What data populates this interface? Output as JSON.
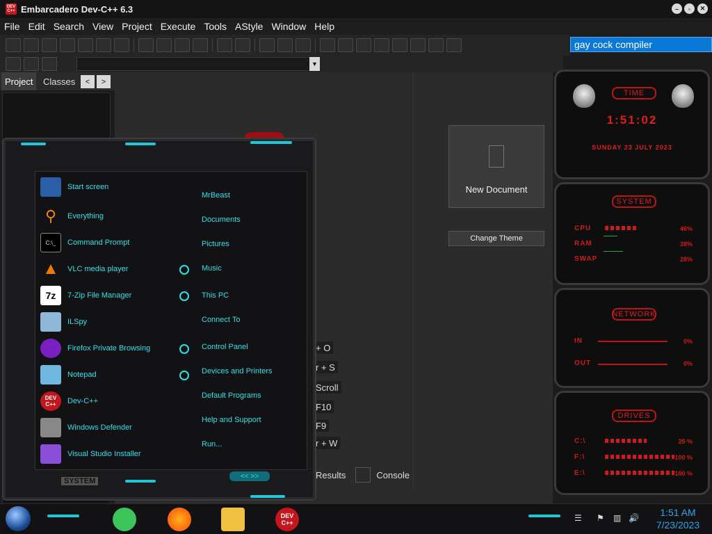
{
  "window": {
    "title": "Embarcadero Dev-C++ 6.3",
    "app_icon_text": "DEV C++"
  },
  "menu": [
    "File",
    "Edit",
    "Search",
    "View",
    "Project",
    "Execute",
    "Tools",
    "AStyle",
    "Window",
    "Help"
  ],
  "search": {
    "value": "gay cock compiler"
  },
  "left_panel": {
    "tab_project": "Project",
    "tab_classes": "Classes",
    "prev": "<",
    "next": ">"
  },
  "editor": {
    "new_document": "New Document",
    "change_theme": "Change Theme",
    "shortcuts": [
      "+ O",
      "r + S",
      "Scroll",
      "F10",
      "F9",
      "r + W"
    ],
    "bottom_tabs": {
      "results": "Results",
      "console": "Console"
    }
  },
  "start_menu": {
    "programs": [
      {
        "label": "Start screen",
        "icon": "start-screen-icon",
        "color": "#2a5fa8"
      },
      {
        "label": "Everything",
        "icon": "magnifier-icon",
        "color": "#f08a10"
      },
      {
        "label": "Command Prompt",
        "icon": "cmd-icon",
        "color": "#000000"
      },
      {
        "label": "VLC media player",
        "icon": "vlc-cone-icon",
        "color": "#f07a00"
      },
      {
        "label": "7-Zip File Manager",
        "icon": "7zip-icon",
        "color": "#ffffff"
      },
      {
        "label": "ILSpy",
        "icon": "ilspy-icon",
        "color": "#8fb8d8"
      },
      {
        "label": "Firefox Private Browsing",
        "icon": "firefox-private-icon",
        "color": "#7a1fc2"
      },
      {
        "label": "Notepad",
        "icon": "notepad-icon",
        "color": "#6fb8e0"
      },
      {
        "label": "Dev-C++",
        "icon": "devcpp-icon",
        "color": "#c4161c"
      },
      {
        "label": "Windows Defender",
        "icon": "defender-icon",
        "color": "#888888"
      },
      {
        "label": "Visual Studio Installer",
        "icon": "vs-installer-icon",
        "color": "#8a4fd8"
      }
    ],
    "links": [
      "MrBeast",
      "Documents",
      "Pictures",
      "Music",
      "This PC",
      "Connect To",
      "Control Panel",
      "Devices and Printers",
      "Default Programs",
      "Help and Support",
      "Run..."
    ],
    "footer": "SYSTEM",
    "nav": "<< >>"
  },
  "widgets": {
    "time": {
      "title": "TIME",
      "clock": "1:51:02",
      "date": "SUNDAY 23 JULY 2023"
    },
    "system": {
      "title": "SYSTEM",
      "rows": [
        {
          "label": "CPU",
          "value": "46%",
          "level": 0.46
        },
        {
          "label": "RAM",
          "value": "38%",
          "level": 0.38
        },
        {
          "label": "SWAP",
          "value": "28%",
          "level": 0.28
        }
      ]
    },
    "network": {
      "title": "NETWORK",
      "rows": [
        {
          "label": "IN",
          "value": "0%"
        },
        {
          "label": "OUT",
          "value": "0%"
        }
      ]
    },
    "drives": {
      "title": "DRIVES",
      "rows": [
        {
          "label": "C:\\",
          "value": "25 %",
          "level": 0.25
        },
        {
          "label": "F:\\",
          "value": "100 %",
          "level": 1.0
        },
        {
          "label": "E:\\",
          "value": "100 %",
          "level": 1.0
        }
      ]
    }
  },
  "taskbar": {
    "apps": [
      {
        "name": "notes-app",
        "color": "#3ac45a"
      },
      {
        "name": "firefox",
        "color": "#ff7a00"
      },
      {
        "name": "file-explorer",
        "color": "#f0c040"
      },
      {
        "name": "devcpp",
        "color": "#c4161c",
        "label": "DEV C++"
      }
    ],
    "time": "1:51 AM",
    "date": "7/23/2023"
  }
}
